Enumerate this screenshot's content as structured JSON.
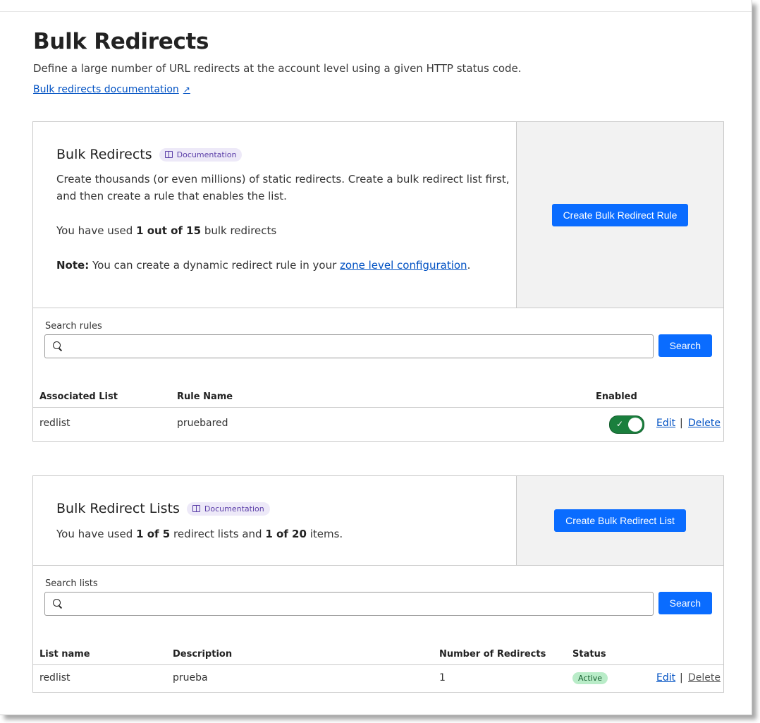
{
  "page": {
    "title": "Bulk Redirects",
    "description": "Define a large number of URL redirects at the account level using a given HTTP status code.",
    "doc_link": "Bulk redirects documentation"
  },
  "rules_card": {
    "title": "Bulk Redirects",
    "badge": "Documentation",
    "description_line1": "Create thousands (or even millions) of static redirects. Create a bulk redirect list first,",
    "description_line2": "and then create a rule that enables the list.",
    "usage_prefix": "You have used",
    "usage_count": "1 out of 15",
    "usage_suffix": "bulk redirects",
    "note_label": "Note:",
    "note_text": "You can create a dynamic redirect rule in your",
    "note_link": "zone level configuration",
    "note_end": ".",
    "create_button": "Create Bulk Redirect Rule",
    "search_label": "Search rules",
    "search_value": "",
    "search_button": "Search",
    "columns": [
      "Associated List",
      "Rule Name",
      "Enabled"
    ],
    "rows": [
      {
        "list": "redlist",
        "rule": "pruebared",
        "enabled": true,
        "edit": "Edit",
        "delete": "Delete"
      }
    ]
  },
  "lists_card": {
    "title": "Bulk Redirect Lists",
    "badge": "Documentation",
    "usage_prefix": "You have used",
    "lists_count": "1 of 5",
    "usage_mid": "redirect lists and",
    "items_count": "1 of 20",
    "usage_suffix": "items.",
    "create_button": "Create Bulk Redirect List",
    "search_label": "Search lists",
    "search_value": "",
    "search_button": "Search",
    "columns": [
      "List name",
      "Description",
      "Number of Redirects",
      "Status"
    ],
    "rows": [
      {
        "name": "redlist",
        "description": "prueba",
        "count": "1",
        "status": "Active",
        "edit": "Edit",
        "delete": "Delete"
      }
    ]
  },
  "colors": {
    "primary": "#0a6cff",
    "link": "#0051c3",
    "toggle_on": "#1a7f3d",
    "status_active_bg": "#b9ecc8",
    "badge_bg": "#ede9f8"
  },
  "icons": {
    "external_link": "external-link-icon",
    "search": "search-icon",
    "documentation": "book-icon",
    "toggle_check": "check-icon"
  }
}
